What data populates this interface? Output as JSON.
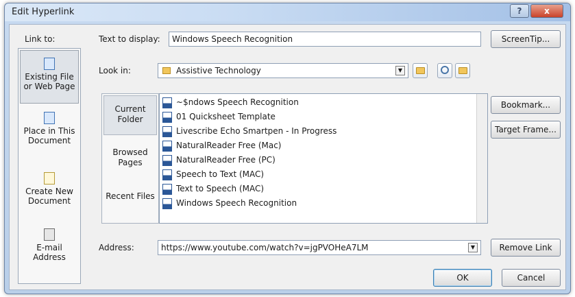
{
  "window": {
    "title": "Edit Hyperlink",
    "help_label": "?",
    "close_label": "x"
  },
  "link_to": {
    "label": "Link to:",
    "items": [
      {
        "label": "Existing File or Web Page",
        "icon": "file-icon"
      },
      {
        "label": "Place in This Document",
        "icon": "globe-icon"
      },
      {
        "label": "Create New Document",
        "icon": "new-document-icon"
      },
      {
        "label": "E-mail Address",
        "icon": "email-icon"
      }
    ]
  },
  "text_to_display": {
    "label": "Text to display:",
    "value": "Windows Speech Recognition"
  },
  "look_in": {
    "label": "Look in:",
    "value": "Assistive Technology"
  },
  "sidetabs": [
    {
      "label": "Current Folder"
    },
    {
      "label": "Browsed Pages"
    },
    {
      "label": "Recent Files"
    }
  ],
  "files": [
    "~$ndows Speech Recognition",
    "01 Quicksheet Template",
    "Livescribe Echo Smartpen - In Progress",
    "NaturalReader Free (Mac)",
    "NaturalReader Free (PC)",
    "Speech to Text (MAC)",
    "Text to Speech (MAC)",
    "Windows Speech Recognition"
  ],
  "address": {
    "label": "Address:",
    "value": "https://www.youtube.com/watch?v=jgPVOHeA7LM"
  },
  "buttons": {
    "screentip": "ScreenTip...",
    "bookmark": "Bookmark...",
    "target_frame": "Target Frame...",
    "remove_link": "Remove Link",
    "ok": "OK",
    "cancel": "Cancel"
  }
}
